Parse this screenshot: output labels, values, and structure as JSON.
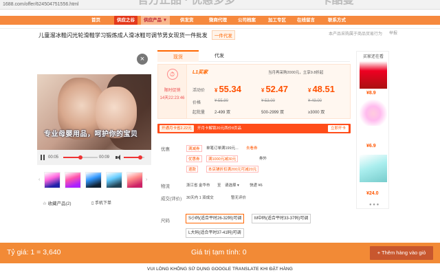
{
  "browser": {
    "url": "1688.com/offer/624504751556.html"
  },
  "hidden_banner": {
    "text_left": "官方正品 · 优惠多多",
    "text_right": "卡酷曼"
  },
  "nav": {
    "items": [
      {
        "label": "首页"
      },
      {
        "label": "供应之谷"
      },
      {
        "label": "供应产品 ▼"
      },
      {
        "label": "供发货"
      },
      {
        "label": "微商代理"
      },
      {
        "label": "公司档案"
      },
      {
        "label": "加工专区"
      },
      {
        "label": "在线留言"
      },
      {
        "label": "联系方式"
      }
    ]
  },
  "product": {
    "title": "儿童溜冰鞋闪光轮滑鞋学习锻炼成人滑冰鞋可调节男女现货一件批发",
    "wholesale_tag": "一件代发",
    "right_info": "本产品采购属于商品贸易行为",
    "report": "举报"
  },
  "video": {
    "caption": "专业母婴用品，呵护你的宝贝",
    "time_current": "00:05",
    "time_total": "00:09",
    "progress_fraction": 0.5,
    "volume_fraction": 0.8
  },
  "left_actions": {
    "favorite": "收藏产品(2)",
    "mobile": "手机下单"
  },
  "tabs": [
    {
      "label": "现货",
      "active": true
    },
    {
      "label": "代发",
      "active": false
    }
  ],
  "promo": {
    "label1": "限时促销",
    "countdown": "14天22:23:46",
    "tier": "L1买家",
    "tier_note": "当月再采购2000元，立享9.8折起",
    "row_labels": [
      "活动价",
      "价格",
      "起批量"
    ],
    "prices": [
      {
        "price": "55.34",
        "orig": "¥ 55.90",
        "moq": "2-499 双"
      },
      {
        "price": "52.47",
        "orig": "¥ 53.00",
        "moq": "500-2999 双"
      },
      {
        "price": "48.51",
        "orig": "¥ 49.00",
        "moq": "≥3000 双"
      }
    ]
  },
  "coupon": {
    "tag": "开通月卡省2.22元",
    "text": "开月卡解锁20元西价8页品",
    "button": "立即开卡"
  },
  "perks": {
    "label": "优惠",
    "items": [
      {
        "tag": "满减券",
        "text": "单笔订单满199元...",
        "more": "去看券"
      },
      {
        "tag": "优惠券",
        "text": "满1000元减30元",
        "more": "券外"
      },
      {
        "tag": "退款",
        "text": "本店铺折扣满200元可减20元",
        "more": ""
      }
    ]
  },
  "shipping": {
    "label": "物流",
    "origin": "浙江省 金华市",
    "to_label": "至",
    "choose": "请选择",
    "express": "快递 ¥6"
  },
  "sales": {
    "label": "成交(评价)",
    "text": "30天内 1 双成交",
    "review": "暂无评价"
  },
  "sizes": {
    "label": "尺码",
    "options": [
      {
        "label": "S小码(适合平时26-32码)可调",
        "selected": true
      },
      {
        "label": "M中码(适合平时33-37码)可调",
        "selected": false
      },
      {
        "label": "L大码(适合平时37-41码)可调",
        "selected": false
      }
    ]
  },
  "recommend": {
    "header": "买家还在看",
    "items": [
      {
        "price": "¥8.9"
      },
      {
        "price": "¥6.9"
      },
      {
        "price": "¥24.0"
      }
    ]
  },
  "bottom_bar": {
    "rate": "Tỷ giá: 1 = 3,640",
    "total": "Giá trị tạm tính: 0",
    "add_button": "+ Thêm hàng vào giỏ"
  },
  "footer_note": "VUI LÒNG KHÔNG SỬ DỤNG GOOGLE TRANSLATE KHI ĐẶT HÀNG",
  "colors": {
    "accent": "#ff5000",
    "bar": "#f28a36",
    "nav": "#f6893e"
  }
}
